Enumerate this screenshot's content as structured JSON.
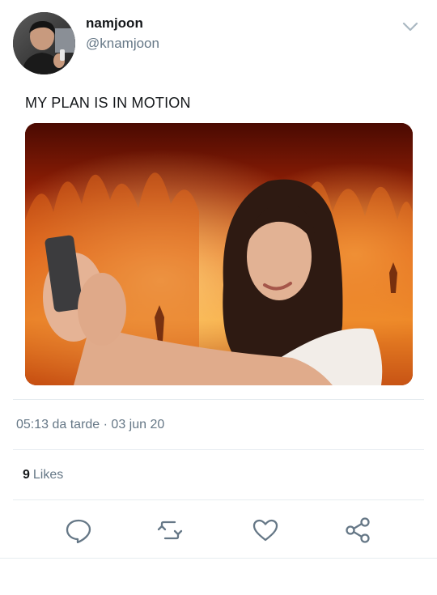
{
  "user": {
    "display_name": "namjoon",
    "handle": "@knamjoon",
    "avatar_icon": "avatar-photo"
  },
  "tweet": {
    "text": "MY PLAN IS IN MOTION",
    "media_description_icon": "image-media",
    "timestamp": "05:13 da tarde · 03 jun 20",
    "likes_count": "9",
    "likes_label": "Likes"
  },
  "actions": {
    "reply_icon": "reply-icon",
    "retweet_icon": "retweet-icon",
    "like_icon": "heart-icon",
    "share_icon": "share-icon"
  },
  "colors": {
    "primary_text": "#14171a",
    "secondary_text": "#657786",
    "divider": "#e6ecf0",
    "icon": "#657786"
  }
}
